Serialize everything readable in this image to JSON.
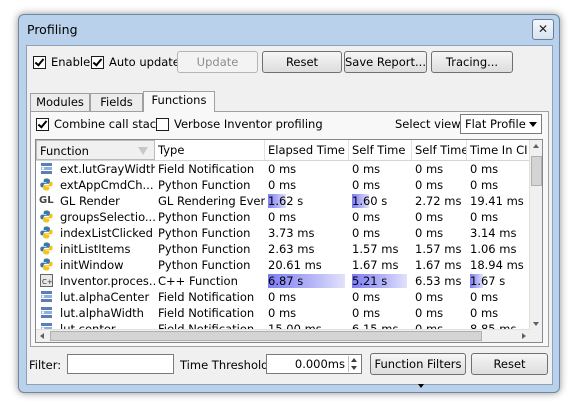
{
  "window": {
    "title": "Profiling",
    "close_glyph": "✕"
  },
  "toolbar": {
    "enable_label": "Enable",
    "auto_update_label": "Auto update",
    "update_label": "Update",
    "reset_label": "Reset",
    "save_report_label": "Save Report...",
    "tracing_label": "Tracing..."
  },
  "tabs": [
    {
      "label": "Modules"
    },
    {
      "label": "Fields"
    },
    {
      "label": "Functions",
      "active": true
    }
  ],
  "options": {
    "combine_label": "Combine call stacks",
    "verbose_label": "Verbose Inventor profiling",
    "select_view_label": "Select view:",
    "select_view_value": "Flat Profile"
  },
  "table": {
    "headers": [
      "Function",
      "Type",
      "Elapsed Time",
      "Self Time",
      "Self Time",
      "Time In CI"
    ],
    "rows": [
      {
        "icon": "field-icon",
        "function": "ext.lutGrayWidth",
        "type": "Field Notification",
        "elapsed": "0 ms",
        "self": "0 ms",
        "self2": "0 ms",
        "timein": "0 ms"
      },
      {
        "icon": "python-icon",
        "function": "extAppCmdCh...",
        "type": "Python Function",
        "elapsed": "0 ms",
        "self": "0 ms",
        "self2": "0 ms",
        "timein": "0 ms"
      },
      {
        "icon": "gl-icon",
        "function": "GL Render",
        "type": "GL Rendering Event",
        "elapsed": "1.62 s",
        "self": "1.60 s",
        "self2": "2.72 ms",
        "timein": "19.41 ms",
        "elapsed_bar": 0.24,
        "self_bar": 0.31
      },
      {
        "icon": "python-icon",
        "function": "groupsSelectio...",
        "type": "Python Function",
        "elapsed": "0 ms",
        "self": "0 ms",
        "self2": "0 ms",
        "timein": "0 ms"
      },
      {
        "icon": "python-icon",
        "function": "indexListClicked",
        "type": "Python Function",
        "elapsed": "3.73 ms",
        "self": "0 ms",
        "self2": "0 ms",
        "timein": "3.14 ms"
      },
      {
        "icon": "python-icon",
        "function": "initListItems",
        "type": "Python Function",
        "elapsed": "2.63 ms",
        "self": "1.57 ms",
        "self2": "1.57 ms",
        "timein": "1.06 ms"
      },
      {
        "icon": "python-icon",
        "function": "initWindow",
        "type": "Python Function",
        "elapsed": "20.61 ms",
        "self": "1.67 ms",
        "self2": "1.67 ms",
        "timein": "18.94 ms"
      },
      {
        "icon": "cpp-icon",
        "function": "Inventor.proces...",
        "type": "C++ Function",
        "elapsed": "6.87 s",
        "self": "5.21 s",
        "self2": "6.53 ms",
        "timein": "1.67 s",
        "elapsed_bar": 1.0,
        "self_bar": 0.98,
        "timein_bar": 0.24
      },
      {
        "icon": "field-icon",
        "function": "lut.alphaCenter",
        "type": "Field Notification",
        "elapsed": "0 ms",
        "self": "0 ms",
        "self2": "0 ms",
        "timein": "0 ms"
      },
      {
        "icon": "field-icon",
        "function": "lut.alphaWidth",
        "type": "Field Notification",
        "elapsed": "0 ms",
        "self": "0 ms",
        "self2": "0 ms",
        "timein": "0 ms"
      },
      {
        "icon": "field-icon",
        "function": "lut.center",
        "type": "Field Notification",
        "elapsed": "15.00 ms",
        "self": "6.15 ms",
        "self2": "0 ms",
        "timein": "8.85 ms"
      }
    ]
  },
  "bottom": {
    "filter_label": "Filter:",
    "filter_value": "",
    "threshold_label": "Time Threshold:",
    "threshold_value": "0.000ms",
    "function_filters_label": "Function Filters",
    "reset_label": "Reset"
  },
  "colors": {
    "bar": "#7d7df5",
    "window_frame": "#b9d1ea"
  }
}
